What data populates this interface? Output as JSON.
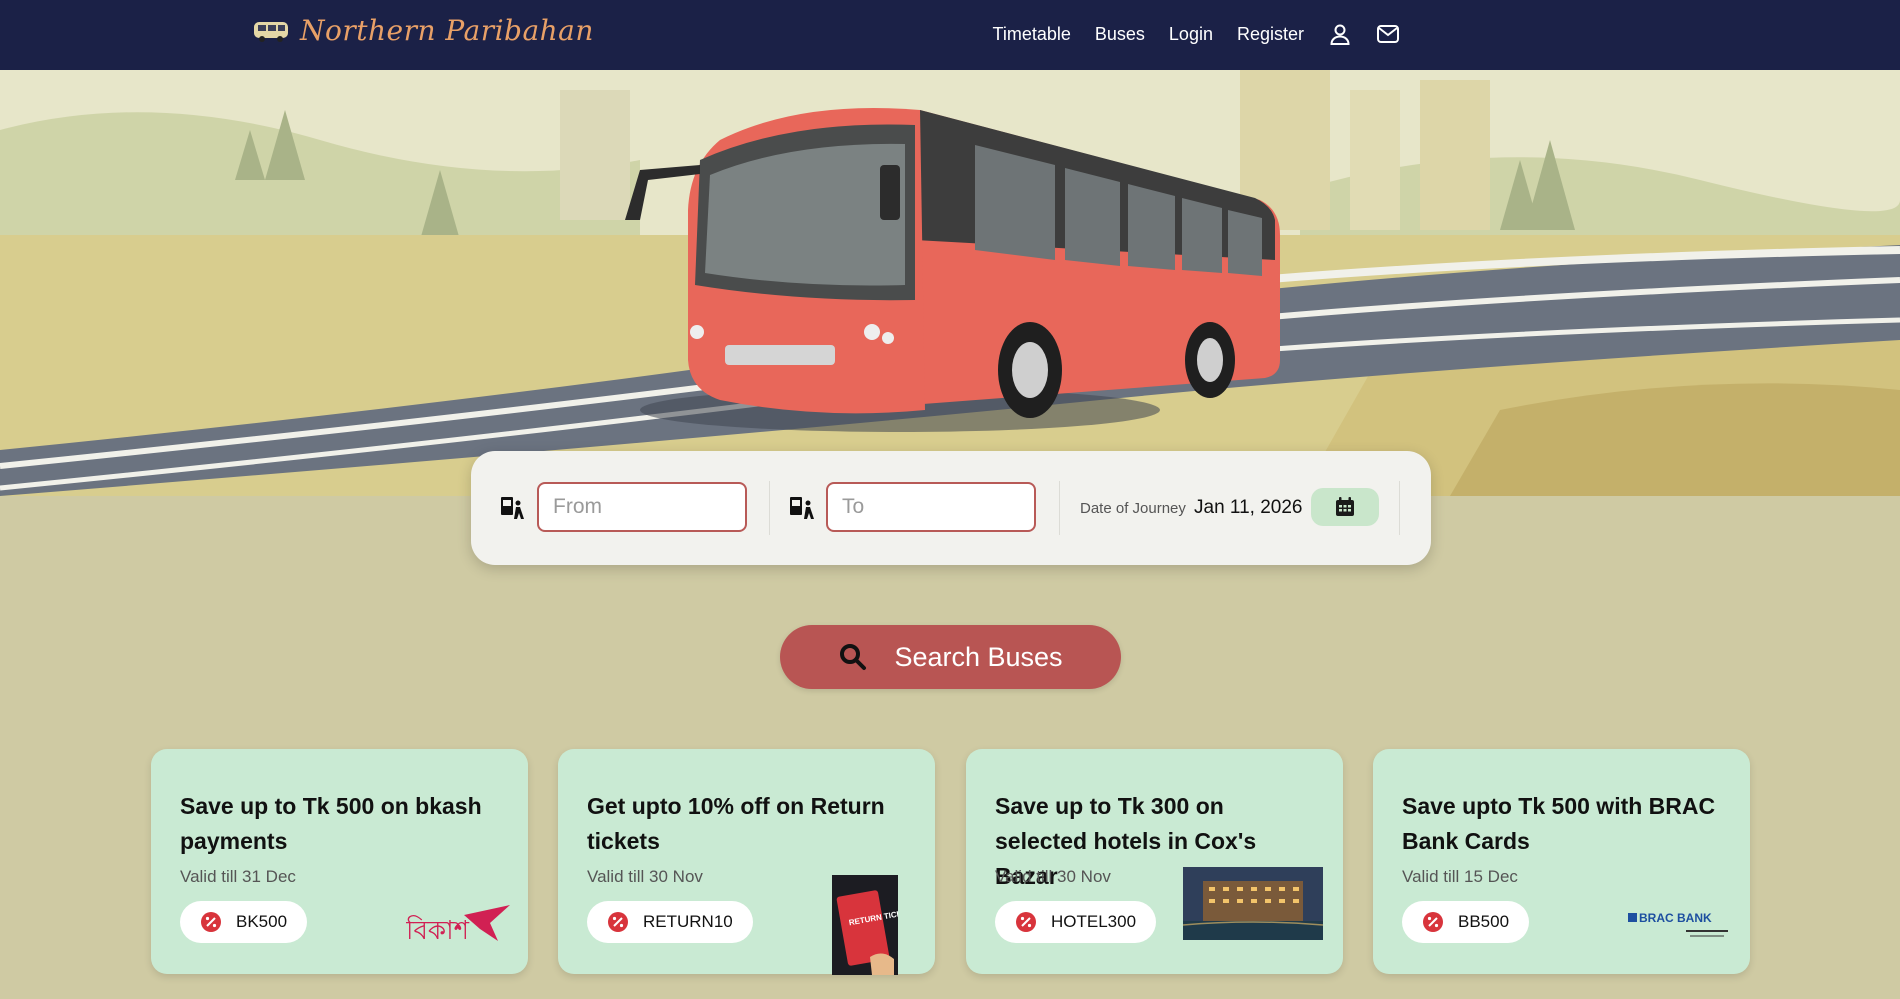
{
  "brand": {
    "name": "Northern Paribahan"
  },
  "nav": {
    "links": [
      "Timetable",
      "Buses",
      "Login",
      "Register"
    ],
    "icons": [
      "user-icon",
      "mail-icon"
    ]
  },
  "search": {
    "from_placeholder": "From",
    "to_placeholder": "To",
    "date_label": "Date of Journey",
    "date_value": "Jan 11, 2026",
    "button_label": "Search Buses"
  },
  "offers": [
    {
      "title": "Save up to Tk 500 on bkash payments",
      "valid": "Valid till 31 Dec",
      "code": "BK500",
      "art": "bkash-logo"
    },
    {
      "title": "Get upto 10% off on Return tickets",
      "valid": "Valid till 30 Nov",
      "code": "RETURN10",
      "art": "return-ticket-image",
      "art_text": "RETURN TICKET"
    },
    {
      "title": "Save up to Tk 300 on selected hotels in Cox's Bazar",
      "valid": "Valid till 30 Nov",
      "code": "HOTEL300",
      "art": "hotel-photo"
    },
    {
      "title": "Save upto Tk 500 with BRAC Bank Cards",
      "valid": "Valid till 15 Dec",
      "code": "BB500",
      "art": "brac-bank-logo"
    }
  ],
  "colors": {
    "nav_bg": "#1b2147",
    "brand_text": "#e8a067",
    "page_bg": "#cfcaa3",
    "accent_red": "#b85553",
    "offer_card_bg": "#c9ead3",
    "bus_body": "#e8675a"
  }
}
